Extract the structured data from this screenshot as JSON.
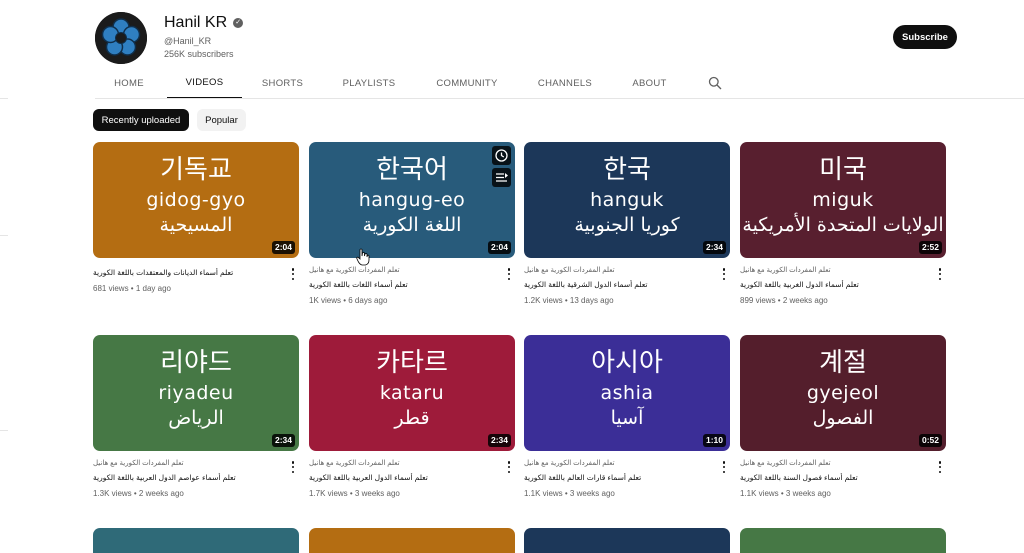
{
  "channel": {
    "name": "Hanil KR",
    "verified_icon": "checkmark-badge-icon",
    "handle": "@Hanil_KR",
    "subscribers": "256K subscribers",
    "subscribe_label": "Subscribe"
  },
  "tabs": [
    "HOME",
    "VIDEOS",
    "SHORTS",
    "PLAYLISTS",
    "COMMUNITY",
    "CHANNELS",
    "ABOUT"
  ],
  "active_tab": "VIDEOS",
  "filters": {
    "selected": "Recently uploaded",
    "other": "Popular"
  },
  "videos": [
    {
      "korean": "기독교",
      "romanized": "gidog-gyo",
      "arabic": "المسيحية",
      "color": "#b46d12",
      "duration": "2:04",
      "channel_line": "",
      "title": "تعلم أسماء الديانات والمعتقدات باللغة الكورية",
      "stats": "681 views • 1 day ago"
    },
    {
      "korean": "한국어",
      "romanized": "hangug-eo",
      "arabic": "اللغة الكورية",
      "color": "#285b7b",
      "duration": "2:04",
      "channel_line": "تعلم المفردات الكورية مع هانيل",
      "title": "تعلم أسماء اللغات باللغة الكورية",
      "stats": "1K views • 6 days ago"
    },
    {
      "korean": "한국",
      "romanized": "hanguk",
      "arabic": "كوريا الجنوبية",
      "color": "#1c3759",
      "duration": "2:34",
      "channel_line": "تعلم المفردات الكورية مع هانيل",
      "title": "تعلم أسماء الدول الشرقية باللغة الكورية",
      "stats": "1.2K views • 13 days ago"
    },
    {
      "korean": "미국",
      "romanized": "miguk",
      "arabic": "الولايات المتحدة الأمريكية",
      "color": "#581f2f",
      "duration": "2:52",
      "channel_line": "تعلم المفردات الكورية مع هانيل",
      "title": "تعلم أسماء الدول الغربية باللغة الكورية",
      "stats": "899 views • 2 weeks ago"
    },
    {
      "korean": "리야드",
      "romanized": "riyadeu",
      "arabic": "الرياض",
      "color": "#467845",
      "duration": "2:34",
      "channel_line": "تعلم المفردات الكورية مع هانيل",
      "title": "تعلم أسماء عواصم الدول العربية باللغة الكورية",
      "stats": "1.3K views • 2 weeks ago"
    },
    {
      "korean": "카타르",
      "romanized": "kataru",
      "arabic": "قطر",
      "color": "#9e1b3a",
      "duration": "2:34",
      "channel_line": "تعلم المفردات الكورية مع هانيل",
      "title": "تعلم أسماء الدول العربية باللغة الكورية",
      "stats": "1.7K views • 3 weeks ago"
    },
    {
      "korean": "아시아",
      "romanized": "ashia",
      "arabic": "آسيا",
      "color": "#3b2e97",
      "duration": "1:10",
      "channel_line": "تعلم المفردات الكورية مع هانيل",
      "title": "تعلم أسماء قارات العالم باللغة الكورية",
      "stats": "1.1K views • 3 weeks ago"
    },
    {
      "korean": "계절",
      "romanized": "gyejeol",
      "arabic": "الفصول",
      "color": "#541e2c",
      "duration": "0:52",
      "channel_line": "تعلم المفردات الكورية مع هانيل",
      "title": "تعلم أسماء فصول السنة باللغة الكورية",
      "stats": "1.1K views • 3 weeks ago"
    }
  ],
  "next_row_colors": [
    "#2f6a78",
    "#b46d12",
    "#1c3759",
    "#467845"
  ],
  "hover_icons": [
    "watch-later-icon",
    "add-to-queue-icon"
  ]
}
